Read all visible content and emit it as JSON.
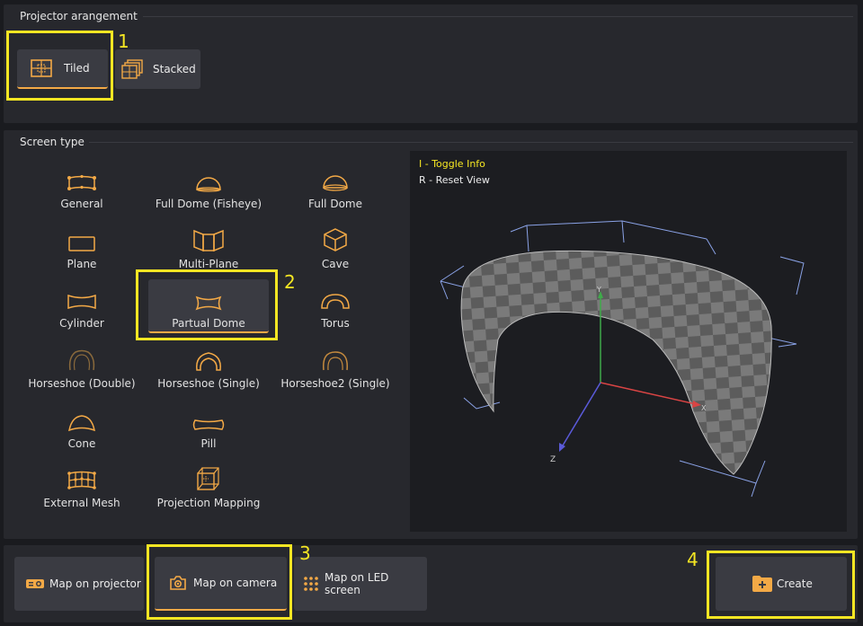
{
  "arrangement": {
    "title": "Projector arangement",
    "buttons": [
      {
        "label": "Tiled",
        "icon": "tiled-icon",
        "selected": true
      },
      {
        "label": "Stacked",
        "icon": "stacked-icon",
        "selected": false
      }
    ]
  },
  "screen_type": {
    "title": "Screen type",
    "items": [
      {
        "label": "General",
        "icon": "general-icon"
      },
      {
        "label": "Full Dome (Fisheye)",
        "icon": "full-dome-fisheye-icon"
      },
      {
        "label": "Full Dome",
        "icon": "full-dome-icon"
      },
      {
        "label": "Plane",
        "icon": "plane-icon"
      },
      {
        "label": "Multi-Plane",
        "icon": "multi-plane-icon"
      },
      {
        "label": "Cave",
        "icon": "cave-icon"
      },
      {
        "label": "Cylinder",
        "icon": "cylinder-icon"
      },
      {
        "label": "Partual Dome",
        "icon": "partial-dome-icon",
        "selected": true
      },
      {
        "label": "Torus",
        "icon": "torus-icon"
      },
      {
        "label": "Horseshoe (Double)",
        "icon": "horseshoe-double-icon"
      },
      {
        "label": "Horseshoe (Single)",
        "icon": "horseshoe-single-icon"
      },
      {
        "label": "Horseshoe2 (Single)",
        "icon": "horseshoe2-single-icon"
      },
      {
        "label": "Cone",
        "icon": "cone-icon"
      },
      {
        "label": "Pill",
        "icon": "pill-icon"
      },
      {
        "label": "External Mesh",
        "icon": "external-mesh-icon"
      },
      {
        "label": "Projection Mapping",
        "icon": "projection-mapping-icon"
      }
    ]
  },
  "viewport": {
    "info_toggle": "I - Toggle Info",
    "reset_view": "R - Reset View",
    "axis_x": "X",
    "axis_y": "Y",
    "axis_z": "Z"
  },
  "bottom": {
    "map_projector": "Map on projector",
    "map_camera": "Map on camera",
    "map_led": "Map on LED screen",
    "create": "Create"
  },
  "callouts": [
    "1",
    "2",
    "3",
    "4"
  ],
  "colors": {
    "accent": "#f3a946",
    "highlight": "#f5e623",
    "axis_x": "#d94444",
    "axis_y": "#3faa4a",
    "axis_z": "#5a5ad8"
  }
}
